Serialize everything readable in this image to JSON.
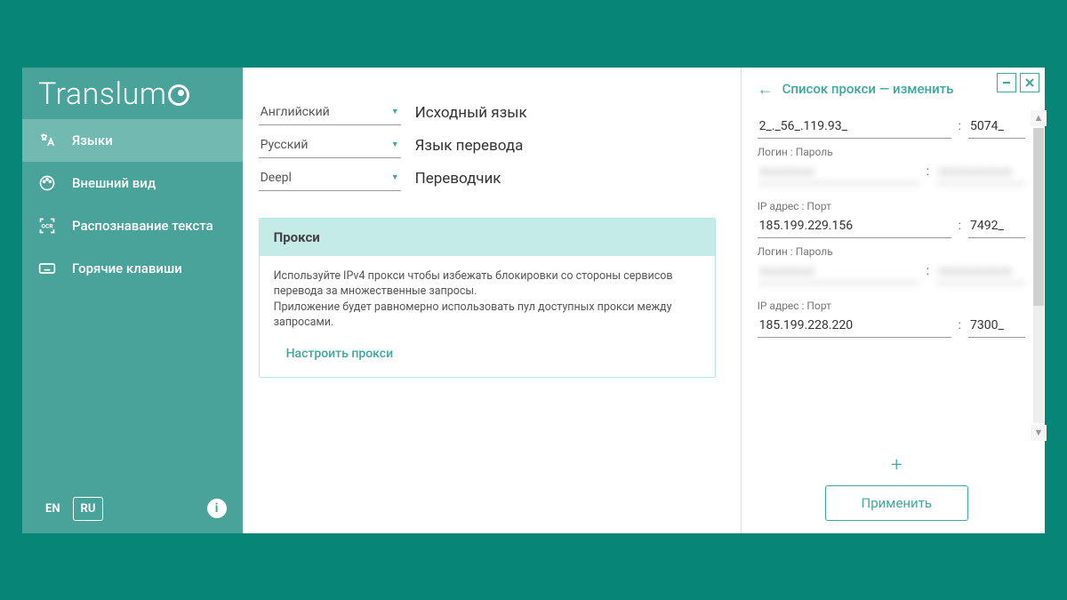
{
  "logo": "Translum",
  "sidebar": {
    "items": [
      {
        "label": "Языки"
      },
      {
        "label": "Внешний вид"
      },
      {
        "label": "Распознавание текста"
      },
      {
        "label": "Горячие клавиши"
      }
    ],
    "lang_en": "EN",
    "lang_ru": "RU",
    "info": "i"
  },
  "selects": {
    "source_lang": {
      "value": "Английский",
      "label": "Исходный язык"
    },
    "target_lang": {
      "value": "Русский",
      "label": "Язык перевода"
    },
    "translator": {
      "value": "Deepl",
      "label": "Переводчик"
    }
  },
  "proxy_card": {
    "title": "Прокси",
    "text": "Используйте IPv4 прокси чтобы избежать блокировки со стороны сервисов перевода за множественные запросы.\nПриложение будет равномерно использовать пул доступных прокси между запросами.",
    "link": "Настроить прокси"
  },
  "right": {
    "title": "Список прокси — изменить",
    "ip_port_label": "IP адрес : Порт",
    "login_pass_label": "Логин : Пароль",
    "add": "+",
    "apply": "Применить",
    "entries": [
      {
        "ip": "2_._56_.119.93_",
        "port": "5074_",
        "login": "xxxxxxxxx",
        "pass": "xxxxxxxxxxxx"
      },
      {
        "ip": "185.199.229.156",
        "port": "7492_",
        "login": "xxxxxxxxx",
        "pass": "xxxxxxxxxxxx"
      },
      {
        "ip": "185.199.228.220",
        "port": "7300_",
        "login": "",
        "pass": ""
      }
    ]
  }
}
